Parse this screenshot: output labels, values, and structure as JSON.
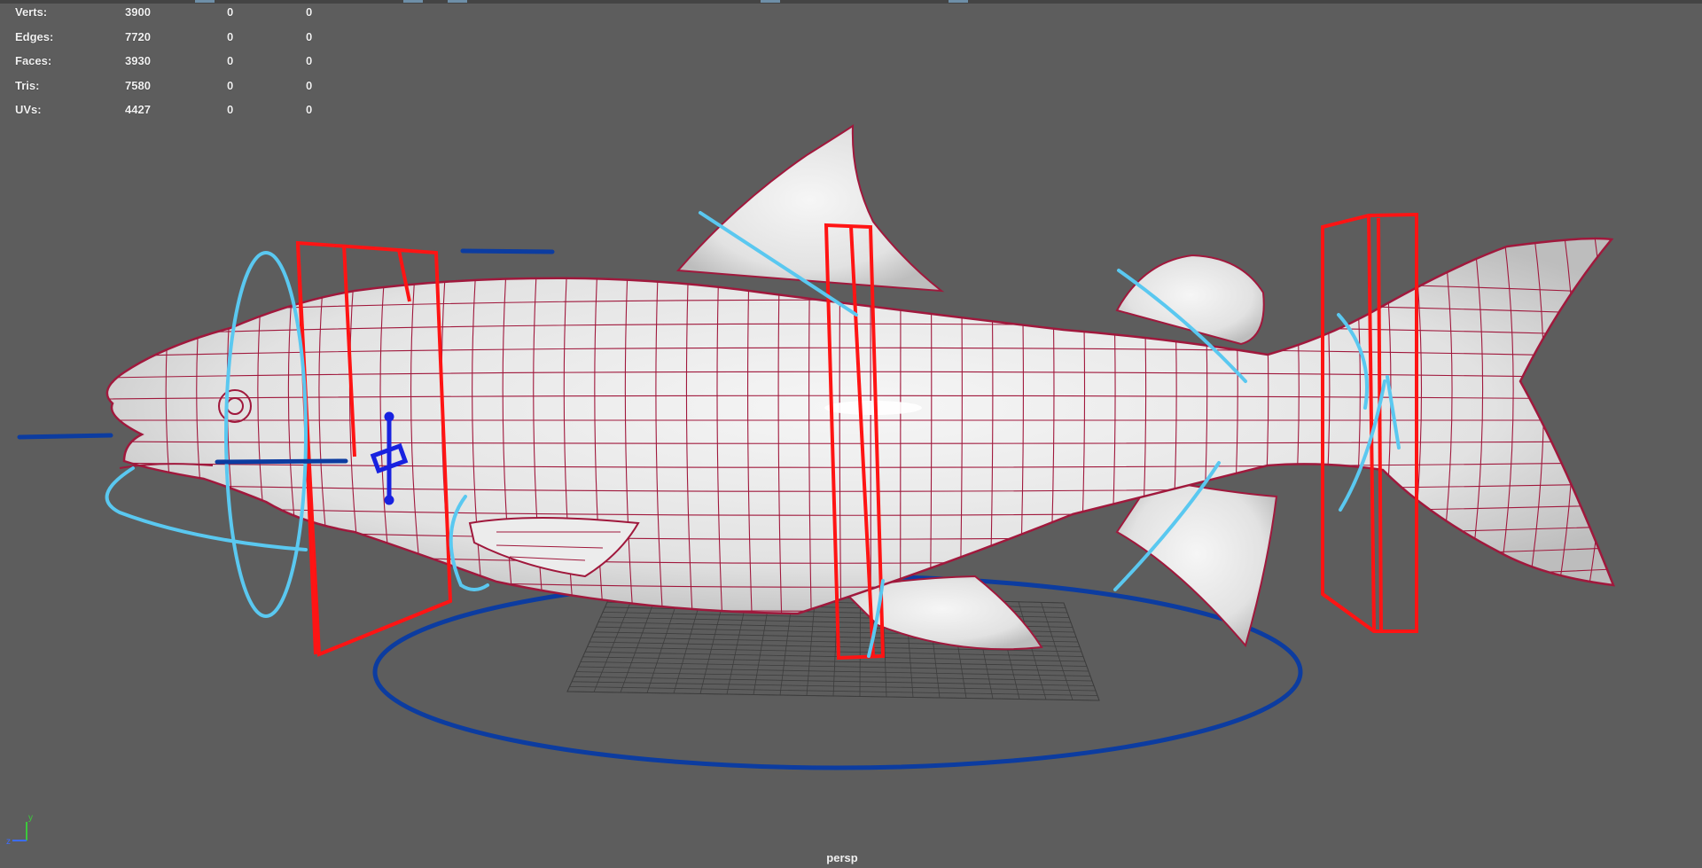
{
  "hud": {
    "rows": [
      {
        "label": "Verts:",
        "v1": "3900",
        "v2": "0",
        "v3": "0"
      },
      {
        "label": "Edges:",
        "v1": "7720",
        "v2": "0",
        "v3": "0"
      },
      {
        "label": "Faces:",
        "v1": "3930",
        "v2": "0",
        "v3": "0"
      },
      {
        "label": "Tris:",
        "v1": "7580",
        "v2": "0",
        "v3": "0"
      },
      {
        "label": "UVs:",
        "v1": "4427",
        "v2": "0",
        "v3": "0"
      }
    ]
  },
  "viewport": {
    "camera": "persp",
    "background": "#5d5d5d",
    "mesh_fill": "#e9e9e9",
    "wire_color": "#a0183c",
    "control_red": "#ff1414",
    "control_light_blue": "#5ac8f0",
    "control_dark_blue": "#0c3ca0",
    "grid_color": "#3c3c3c"
  },
  "axis_gizmo": {
    "y_label": "y",
    "z_label": "z"
  }
}
